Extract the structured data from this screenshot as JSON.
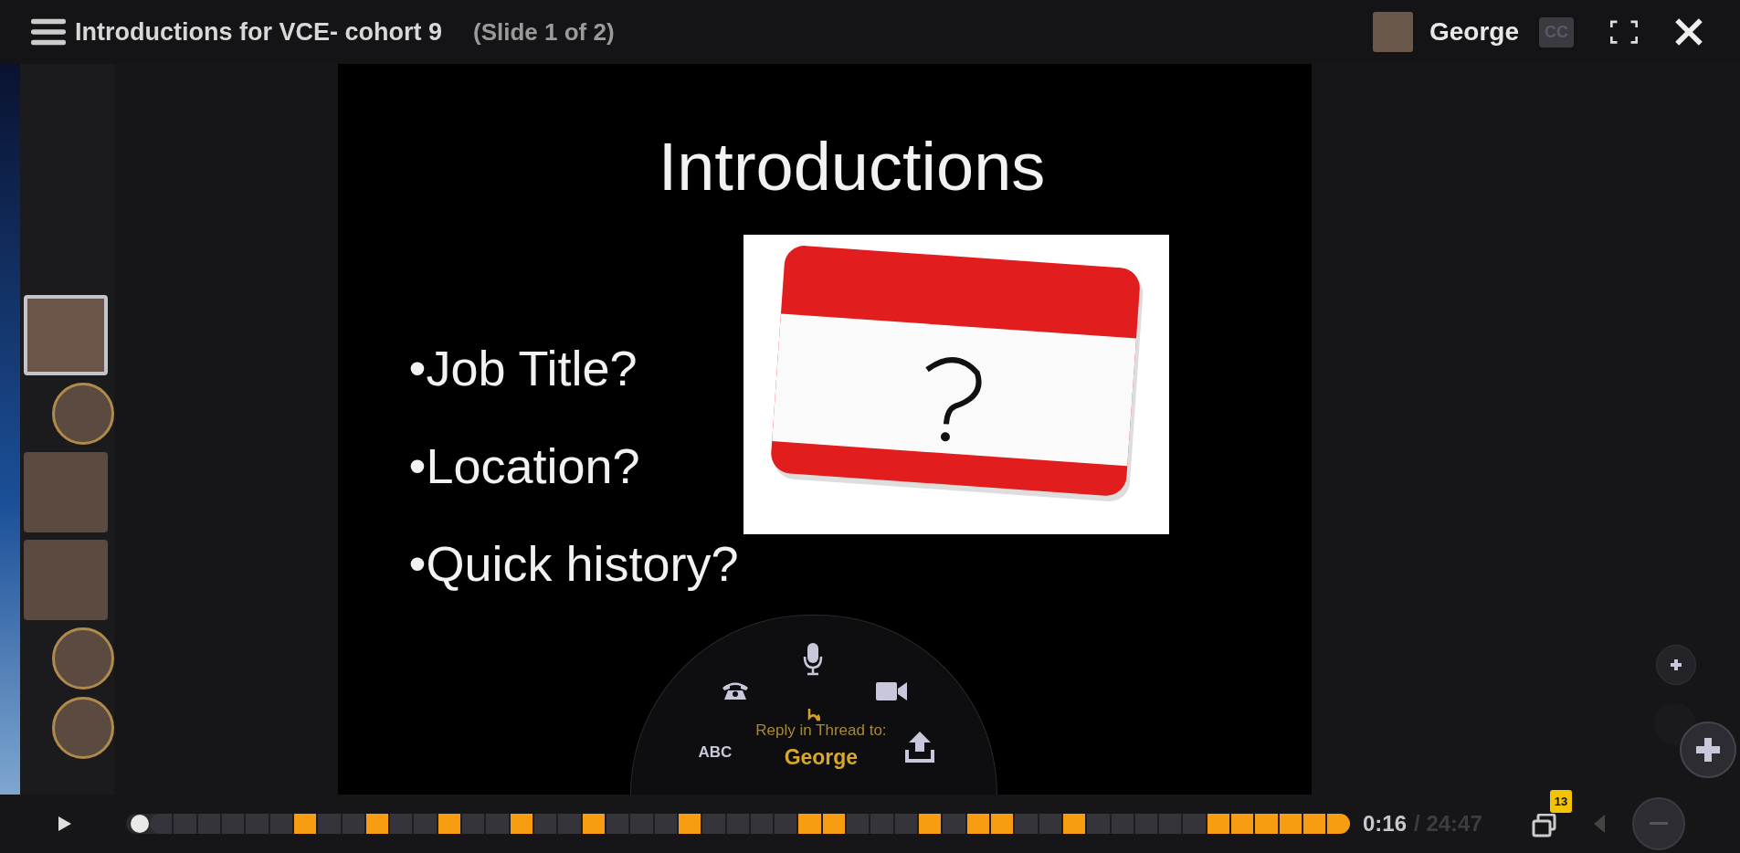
{
  "top_bar": {
    "title": "Introductions for VCE- cohort 9",
    "slide_indicator": "(Slide 1 of 2)",
    "user_name": "George",
    "cc_label": "CC"
  },
  "thread": [
    {
      "kind": "post",
      "selected": true
    },
    {
      "kind": "reply",
      "selected": false
    },
    {
      "kind": "post",
      "selected": false
    },
    {
      "kind": "post",
      "selected": false
    },
    {
      "kind": "reply",
      "selected": false
    },
    {
      "kind": "reply",
      "selected": false
    }
  ],
  "slide": {
    "title": "Introductions",
    "bullets": [
      "•Job Title?",
      "•Location?",
      "•Quick history?"
    ]
  },
  "reply_panel": {
    "abc_label": "ABC",
    "prompt": "Reply in Thread to:",
    "recipient": "George"
  },
  "timeline": {
    "level": 0.02,
    "segments": [
      {
        "highlighted": false
      },
      {
        "highlighted": false
      },
      {
        "highlighted": false
      },
      {
        "highlighted": false
      },
      {
        "highlighted": false
      },
      {
        "highlighted": false
      },
      {
        "highlighted": true
      },
      {
        "highlighted": false
      },
      {
        "highlighted": false
      },
      {
        "highlighted": true
      },
      {
        "highlighted": false
      },
      {
        "highlighted": false
      },
      {
        "highlighted": true
      },
      {
        "highlighted": false
      },
      {
        "highlighted": false
      },
      {
        "highlighted": true
      },
      {
        "highlighted": false
      },
      {
        "highlighted": false
      },
      {
        "highlighted": true
      },
      {
        "highlighted": false
      },
      {
        "highlighted": false
      },
      {
        "highlighted": false
      },
      {
        "highlighted": true
      },
      {
        "highlighted": false
      },
      {
        "highlighted": false
      },
      {
        "highlighted": false
      },
      {
        "highlighted": false
      },
      {
        "highlighted": true
      },
      {
        "highlighted": true
      },
      {
        "highlighted": false
      },
      {
        "highlighted": false
      },
      {
        "highlighted": false
      },
      {
        "highlighted": true
      },
      {
        "highlighted": false
      },
      {
        "highlighted": true
      },
      {
        "highlighted": true
      },
      {
        "highlighted": false
      },
      {
        "highlighted": false
      },
      {
        "highlighted": true
      },
      {
        "highlighted": false
      },
      {
        "highlighted": false
      },
      {
        "highlighted": false
      },
      {
        "highlighted": false
      },
      {
        "highlighted": false
      },
      {
        "highlighted": true
      },
      {
        "highlighted": true
      },
      {
        "highlighted": true
      },
      {
        "highlighted": true
      },
      {
        "highlighted": true
      },
      {
        "highlighted": true
      }
    ],
    "current_time": "0:16",
    "total_time": "/ 24:47",
    "comment_count": "13"
  }
}
